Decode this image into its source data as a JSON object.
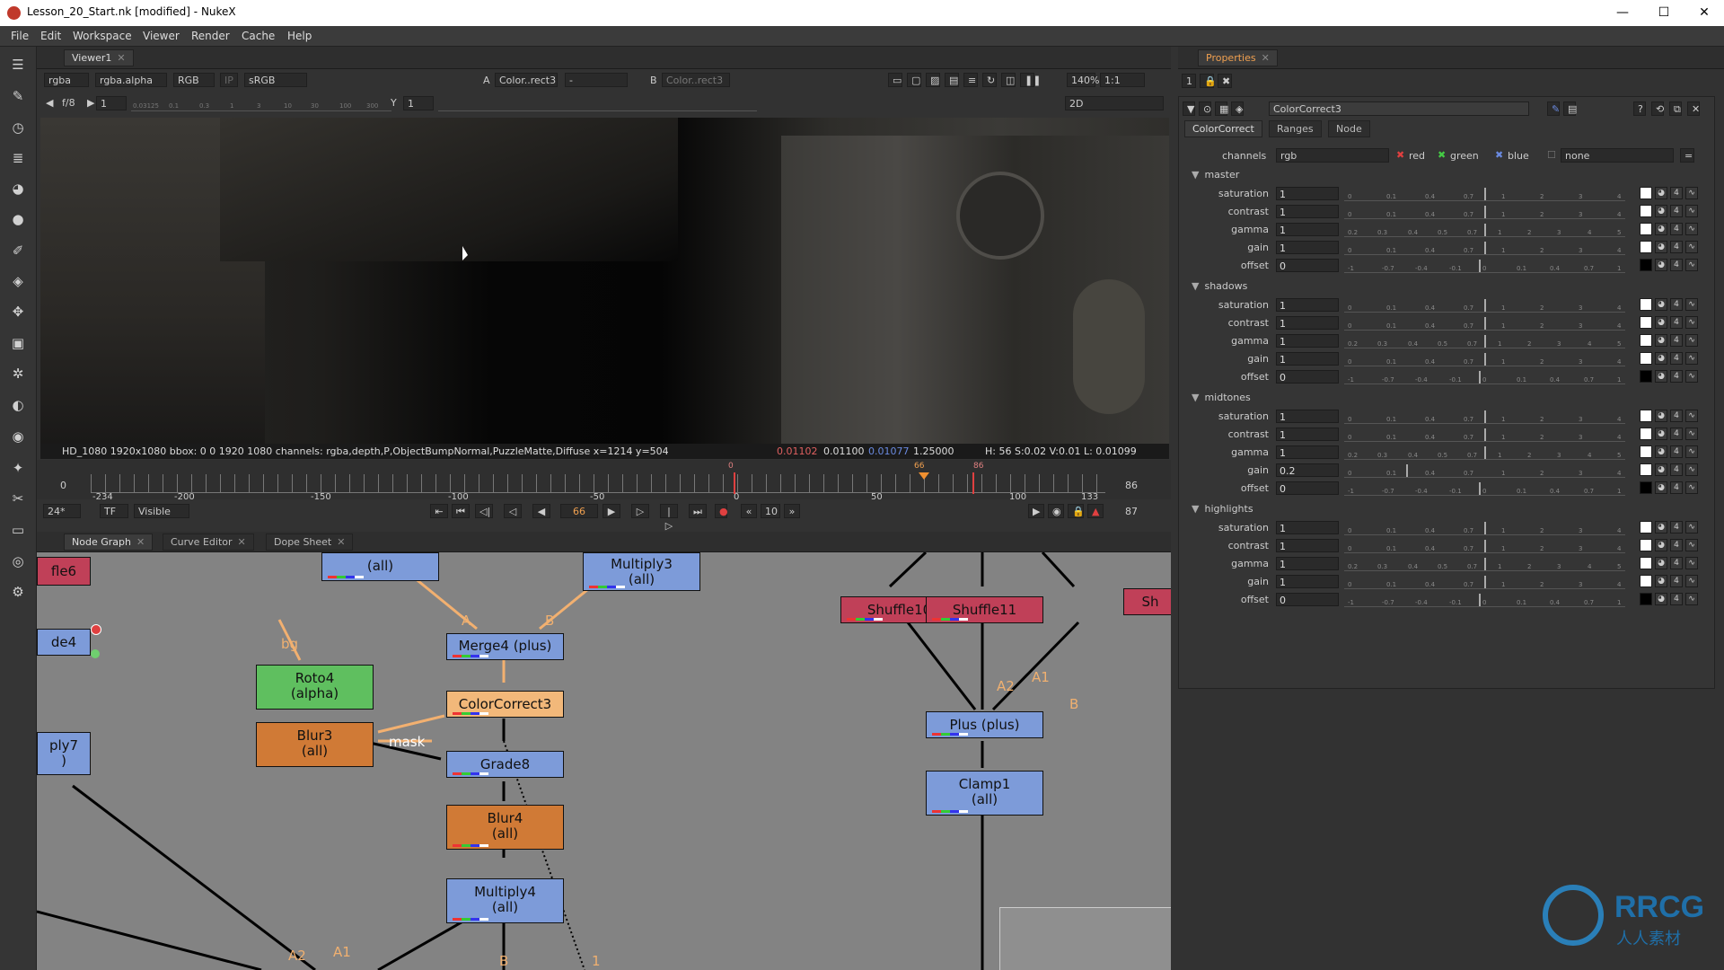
{
  "window": {
    "title": "Lesson_20_Start.nk [modified] - NukeX",
    "controls": [
      "—",
      "☐",
      "✕"
    ]
  },
  "menu": [
    "File",
    "Edit",
    "Workspace",
    "Viewer",
    "Render",
    "Cache",
    "Help"
  ],
  "viewer": {
    "tab": "Viewer1",
    "channel_set": "rgba",
    "alpha_channel": "rgba.alpha",
    "display_mode": "RGB",
    "ip": "IP",
    "lut": "sRGB",
    "input_a_label": "A",
    "input_a": "Color..rect3",
    "input_a_op": "-",
    "input_b_label": "B",
    "input_b": "Color..rect3",
    "zoom": "140%",
    "ratio": "1:1",
    "view_mode": "2D",
    "fstop": "f/8",
    "gain_value": "1",
    "gamma_label": "Y",
    "gamma_value": "1",
    "gain_ticks": [
      "0.03125",
      "0.1",
      "0.3",
      "1",
      "3",
      "10",
      "30",
      "100",
      "300"
    ],
    "status_info": "HD_1080 1920x1080  bbox: 0 0 1920 1080 channels: rgba,depth,P,ObjectBumpNormal,PuzzleMatte,Diffuse  x=1214 y=504",
    "pixel_r": "0.01102",
    "pixel_g": "0.01100",
    "pixel_b": "0.01077",
    "pixel_a": "1.25000",
    "hsv": "H: 56 S:0.02 V:0.01  L: 0.01099"
  },
  "timeline": {
    "start": "0",
    "end": "86",
    "ticks": [
      "-234",
      "-200",
      "-150",
      "-100",
      "-50",
      "0",
      "50",
      "100",
      "133"
    ],
    "marker_a": "0",
    "marker_b": "66",
    "marker_c": "86",
    "fps": "24*",
    "tf": "TF",
    "visible": "Visible",
    "current_frame": "66",
    "step": "10",
    "last_frame": "87",
    "controls": [
      "⇤",
      "⏮",
      "◁|",
      "◁",
      "◀",
      "▶",
      "▷",
      "|▷",
      "⏭"
    ]
  },
  "graph_tabs": [
    {
      "label": "Node Graph"
    },
    {
      "label": "Curve Editor"
    },
    {
      "label": "Dope Sheet"
    }
  ],
  "nodes": {
    "fle6": "fle6",
    "de4": "de4",
    "ply7_a": "ply7",
    "ply7_b": ")",
    "multiply_top": "(all)",
    "multiply3_a": "Multiply3",
    "multiply3_b": "(all)",
    "merge4": "Merge4 (plus)",
    "roto4_a": "Roto4",
    "roto4_b": "(alpha)",
    "colorcorrect3": "ColorCorrect3",
    "blur3_a": "Blur3",
    "blur3_b": "(all)",
    "grade8": "Grade8",
    "blur4_a": "Blur4",
    "blur4_b": "(all)",
    "multiply4_a": "Multiply4",
    "multiply4_b": "(all)",
    "shuffle10": "Shuffle10",
    "shuffle11": "Shuffle11",
    "sh": "Sh",
    "plus": "Plus (plus)",
    "clamp1_a": "Clamp1",
    "clamp1_b": "(all)"
  },
  "edge_labels": {
    "a_merge": "A",
    "b_merge": "B",
    "bg": "bg",
    "mask": "mask",
    "a2_plus": "A2",
    "a1_plus": "A1",
    "b_plus": "B",
    "a2_bottom": "A2",
    "a1_bottom": "A1",
    "b_bottom": "B",
    "one_bottom": "1",
    "a_bottom": "A"
  },
  "properties": {
    "tab": "Properties",
    "count": "1",
    "node_name": "ColorCorrect3",
    "subtabs": [
      "ColorCorrect",
      "Ranges",
      "Node"
    ],
    "channels_label": "channels",
    "channels_value": "rgb",
    "chk_red": "red",
    "chk_green": "green",
    "chk_blue": "blue",
    "extra_channel": "none",
    "slider_ticks": [
      "0",
      "0.1",
      "0.4",
      "0.7",
      "1",
      "2",
      "3",
      "4"
    ],
    "gamma_ticks": [
      "0.2",
      "0.3",
      "0.4",
      "0.5",
      "0.7",
      "1",
      "2",
      "3",
      "4",
      "5"
    ],
    "offset_ticks": [
      "-1",
      "-0.7",
      "-0.4",
      "-0.1",
      "0",
      "0.1",
      "0.4",
      "0.7",
      "1"
    ],
    "sections": [
      {
        "name": "master",
        "rows": [
          {
            "label": "saturation",
            "value": "1"
          },
          {
            "label": "contrast",
            "value": "1"
          },
          {
            "label": "gamma",
            "value": "1"
          },
          {
            "label": "gain",
            "value": "1"
          },
          {
            "label": "offset",
            "value": "0"
          }
        ]
      },
      {
        "name": "shadows",
        "rows": [
          {
            "label": "saturation",
            "value": "1"
          },
          {
            "label": "contrast",
            "value": "1"
          },
          {
            "label": "gamma",
            "value": "1"
          },
          {
            "label": "gain",
            "value": "1"
          },
          {
            "label": "offset",
            "value": "0"
          }
        ]
      },
      {
        "name": "midtones",
        "rows": [
          {
            "label": "saturation",
            "value": "1"
          },
          {
            "label": "contrast",
            "value": "1"
          },
          {
            "label": "gamma",
            "value": "1"
          },
          {
            "label": "gain",
            "value": "0.2"
          },
          {
            "label": "offset",
            "value": "0"
          }
        ]
      },
      {
        "name": "highlights",
        "rows": [
          {
            "label": "saturation",
            "value": "1"
          },
          {
            "label": "contrast",
            "value": "1"
          },
          {
            "label": "gamma",
            "value": "1"
          },
          {
            "label": "gain",
            "value": "1"
          },
          {
            "label": "offset",
            "value": "0"
          }
        ]
      }
    ],
    "row_button_num": "4"
  },
  "watermark": {
    "brand": "RRCG",
    "subtitle": "人人素材"
  }
}
